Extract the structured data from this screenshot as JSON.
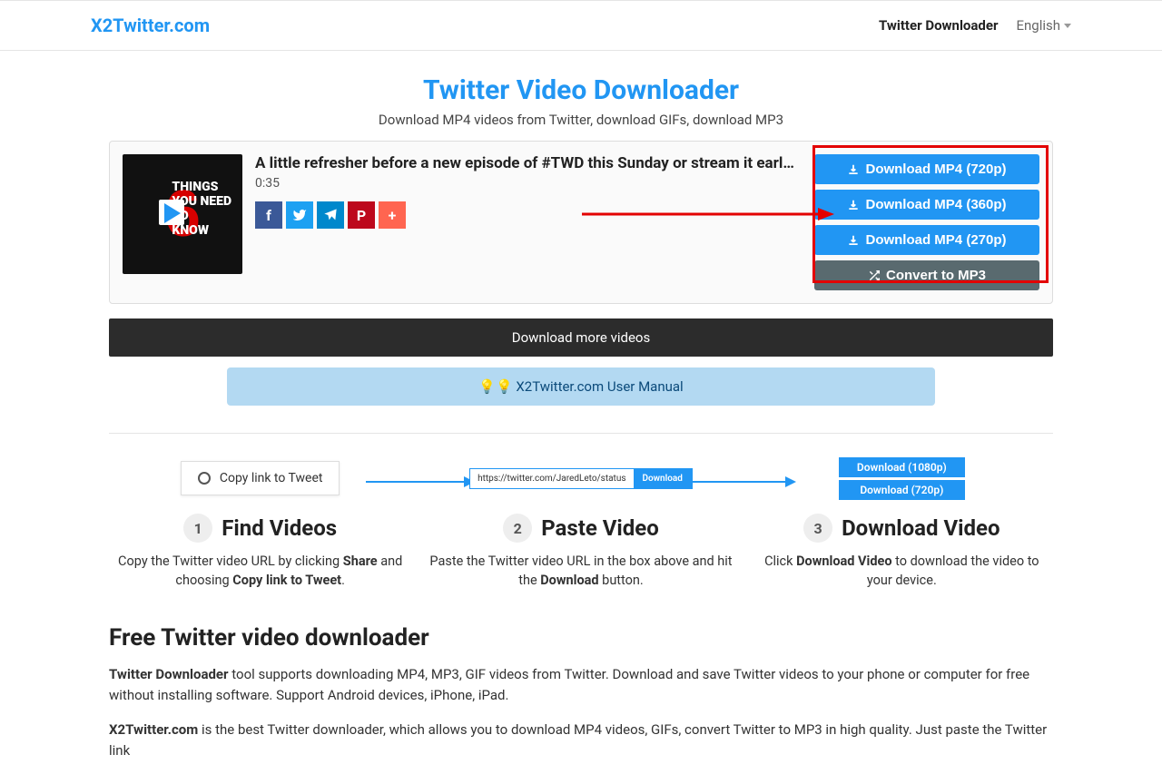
{
  "header": {
    "logo": "X2Twitter.com",
    "nav_downloader": "Twitter Downloader",
    "language": "English"
  },
  "hero": {
    "title": "Twitter Video Downloader",
    "subtitle": "Download MP4 videos from Twitter, download GIFs, download MP3"
  },
  "result": {
    "thumb_text_lines": [
      "THINGS",
      "YOU NEED",
      "TO",
      "KNOW"
    ],
    "title": "A little refresher before a new episode of #TWD this Sunday or stream it early with @..",
    "duration": "0:35",
    "downloads": [
      "Download MP4 (720p)",
      "Download MP4 (360p)",
      "Download MP4 (270p)"
    ],
    "convert": "Convert to MP3"
  },
  "more_btn": "Download more videos",
  "manual_btn": "X2Twitter.com User Manual",
  "steps": {
    "copylink_label": "Copy link to Tweet",
    "paste_url": "https://twitter.com/JaredLeto/status",
    "paste_btn": "Download",
    "dl_1080": "Download (1080p)",
    "dl_720": "Download (720p)",
    "s": [
      {
        "num": "1",
        "title": "Find Videos",
        "desc_pre": "Copy the Twitter video URL by clicking ",
        "desc_b1": "Share",
        "desc_mid": " and choosing ",
        "desc_b2": "Copy link to Tweet",
        "desc_post": "."
      },
      {
        "num": "2",
        "title": "Paste Video",
        "desc_pre": "Paste the Twitter video URL in the box above and hit the ",
        "desc_b1": "Download",
        "desc_mid": " button.",
        "desc_b2": "",
        "desc_post": ""
      },
      {
        "num": "3",
        "title": "Download Video",
        "desc_pre": "Click ",
        "desc_b1": "Download Video",
        "desc_mid": " to download the video to your device.",
        "desc_b2": "",
        "desc_post": ""
      }
    ]
  },
  "article": {
    "heading": "Free Twitter video downloader",
    "p1_b": "Twitter Downloader",
    "p1": " tool supports downloading MP4, MP3, GIF videos from Twitter. Download and save Twitter videos to your phone or computer for free without installing software. Support Android devices, iPhone, iPad.",
    "p2_b": "X2Twitter.com",
    "p2": " is the best Twitter downloader, which allows you to download MP4 videos, GIFs, convert Twitter to MP3 in high quality. Just paste the Twitter link"
  }
}
